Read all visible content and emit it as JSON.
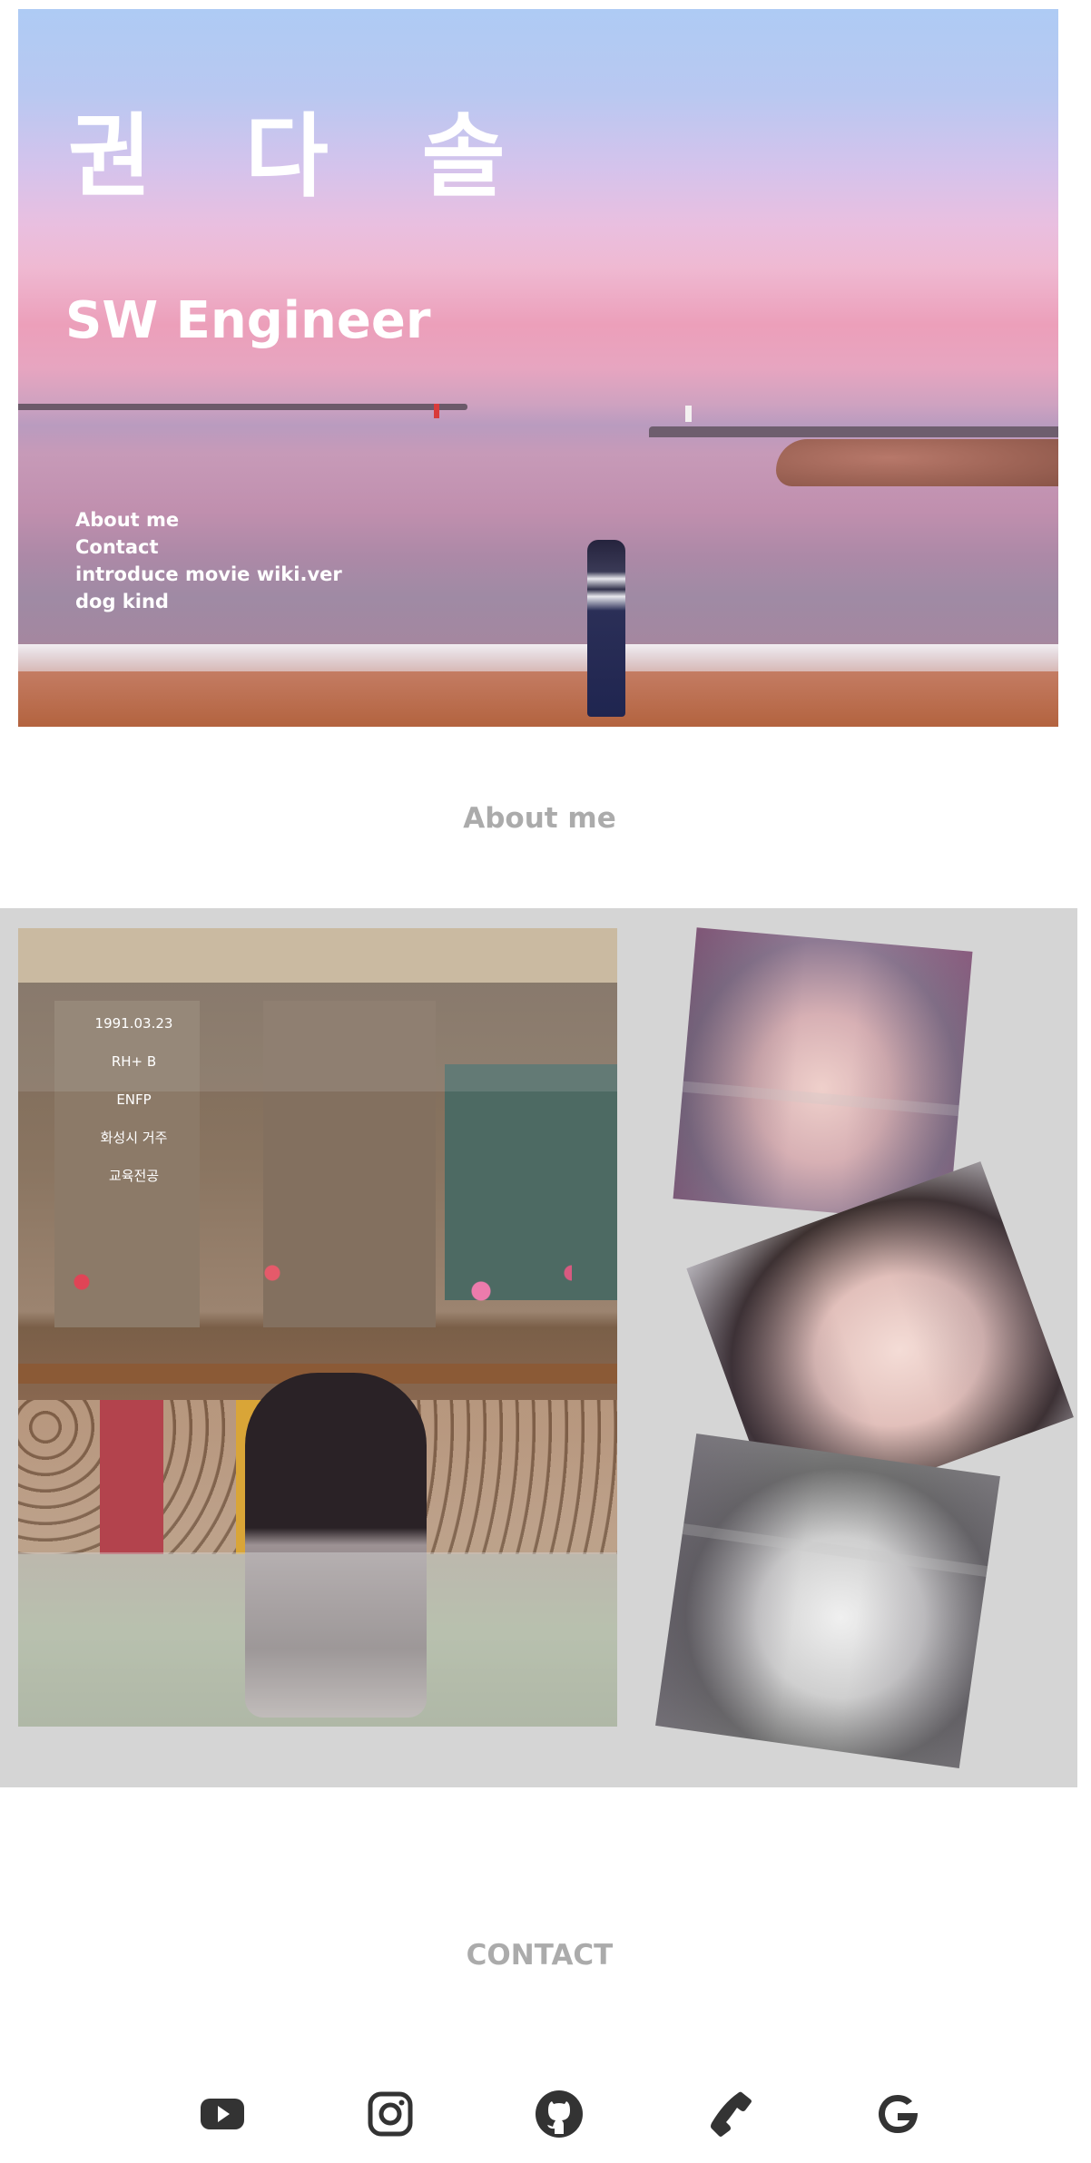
{
  "hero": {
    "title": "권 다 솔",
    "subtitle": "SW Engineer",
    "nav": [
      {
        "label": "About me"
      },
      {
        "label": "Contact"
      },
      {
        "label": "introduce movie wiki.ver"
      },
      {
        "label": "dog kind"
      }
    ]
  },
  "about": {
    "heading": "About me",
    "profile": [
      "1991.03.23",
      "RH+ B",
      "ENFP",
      "화성시 거주",
      "교육전공"
    ]
  },
  "contact": {
    "heading": "CONTACT",
    "links": [
      {
        "icon": "youtube-icon"
      },
      {
        "icon": "instagram-icon"
      },
      {
        "icon": "github-icon"
      },
      {
        "icon": "phone-icon"
      },
      {
        "icon": "google-icon"
      }
    ]
  },
  "colors": {
    "heading_gray": "#ababab",
    "panel_gray": "#d5d5d5",
    "icon_dark": "#333333"
  }
}
